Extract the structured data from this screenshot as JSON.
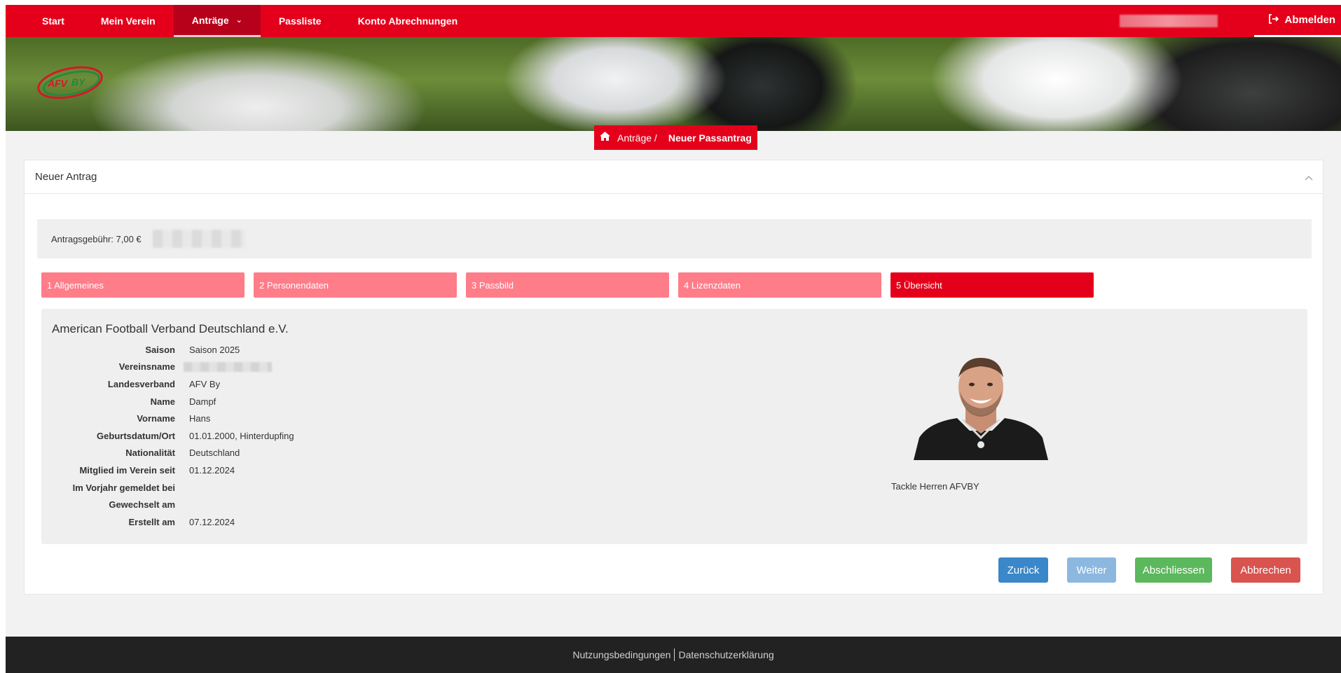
{
  "nav": {
    "items": [
      {
        "label": "Start"
      },
      {
        "label": "Mein Verein"
      },
      {
        "label": "Anträge"
      },
      {
        "label": "Passliste"
      },
      {
        "label": "Konto Abrechnungen"
      }
    ],
    "logout_label": "Abmelden"
  },
  "logo_text": "AFVBY",
  "breadcrumb": {
    "parent": "Anträge /",
    "current": "Neuer Passantrag"
  },
  "panel": {
    "title": "Neuer Antrag",
    "fee_label": "Antragsgebühr: 7,00 €"
  },
  "steps": [
    {
      "label": "1 Allgemeines"
    },
    {
      "label": "2 Personendaten"
    },
    {
      "label": "3 Passbild"
    },
    {
      "label": "4 Lizenzdaten"
    },
    {
      "label": "5 Übersicht"
    }
  ],
  "summary": {
    "org_name": "American Football Verband Deutschland e.V.",
    "fields": [
      {
        "label": "Saison",
        "value": "Saison 2025"
      },
      {
        "label": "Vereinsname",
        "value": ""
      },
      {
        "label": "Landesverband",
        "value": "AFV By"
      },
      {
        "label": "Name",
        "value": "Dampf"
      },
      {
        "label": "Vorname",
        "value": "Hans"
      },
      {
        "label": "Geburtsdatum/Ort",
        "value": "01.01.2000, Hinterdupfing"
      },
      {
        "label": "Nationalität",
        "value": "Deutschland"
      },
      {
        "label": "Mitglied im Verein seit",
        "value": "01.12.2024"
      },
      {
        "label": "Im Vorjahr gemeldet bei",
        "value": ""
      },
      {
        "label": "Gewechselt am",
        "value": ""
      },
      {
        "label": "Erstellt am",
        "value": "07.12.2024"
      }
    ],
    "license": "Tackle Herren AFVBY"
  },
  "buttons": {
    "back": "Zurück",
    "next": "Weiter",
    "finish": "Abschliessen",
    "cancel": "Abbrechen"
  },
  "footer": {
    "terms": "Nutzungsbedingungen",
    "privacy": "Datenschutzerklärung"
  },
  "colors": {
    "brand_red": "#e4001b",
    "step_inactive": "#ff7c89",
    "btn_primary": "#3a87c9",
    "btn_success": "#5cb85c",
    "btn_danger": "#d9534f"
  }
}
